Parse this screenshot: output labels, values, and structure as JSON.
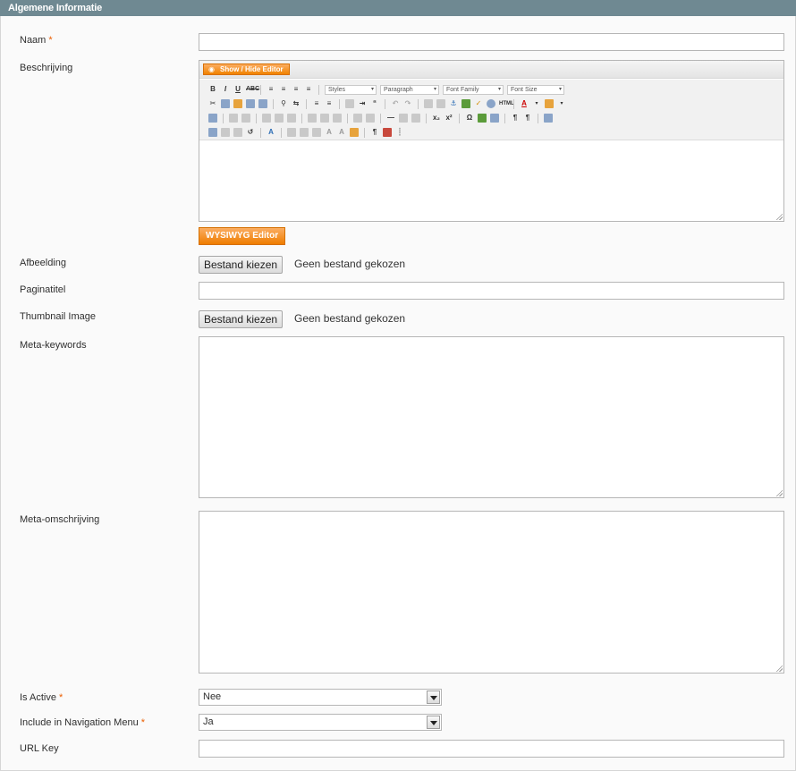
{
  "section": {
    "title": "Algemene Informatie"
  },
  "fields": {
    "naam": {
      "label": "Naam",
      "required": "*"
    },
    "beschrijving": {
      "label": "Beschrijving"
    },
    "afbeelding": {
      "label": "Afbeelding",
      "button": "Bestand kiezen",
      "status": "Geen bestand gekozen"
    },
    "paginatitel": {
      "label": "Paginatitel"
    },
    "thumbnail": {
      "label": "Thumbnail Image",
      "button": "Bestand kiezen",
      "status": "Geen bestand gekozen"
    },
    "meta_keywords": {
      "label": "Meta-keywords"
    },
    "meta_omschrijving": {
      "label": "Meta-omschrijving"
    },
    "is_active": {
      "label": "Is Active",
      "required": "*",
      "value": "Nee"
    },
    "nav_menu": {
      "label": "Include in Navigation Menu",
      "required": "*",
      "value": "Ja"
    },
    "url_key": {
      "label": "URL Key"
    }
  },
  "editor": {
    "toggle_label": "Show / Hide Editor",
    "wysiwyg_label": "WYSIWYG Editor",
    "selects": {
      "styles": "Styles",
      "paragraph": "Paragraph",
      "font_family": "Font Family",
      "font_size": "Font Size"
    }
  },
  "colors": {
    "header_bg": "#6f8992",
    "accent_orange": "#f18200",
    "required": "#eb5e00"
  }
}
